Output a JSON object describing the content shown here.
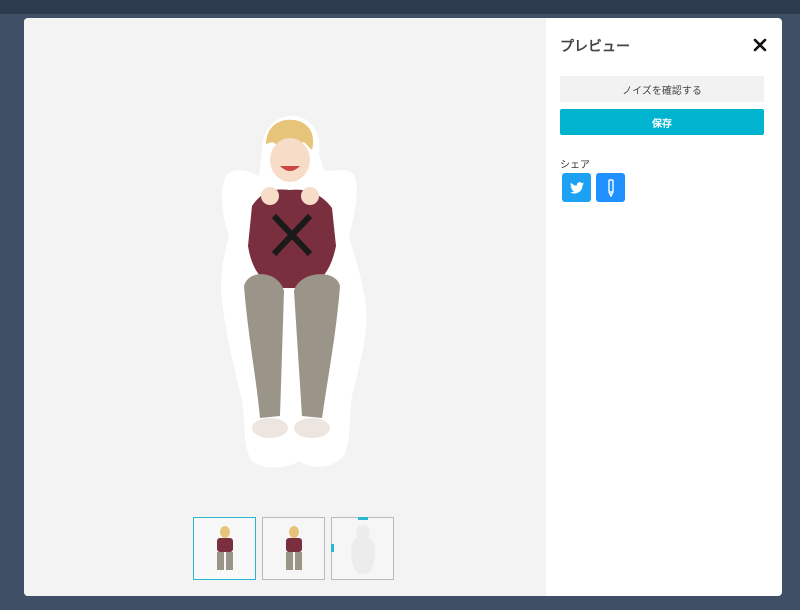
{
  "modal": {
    "title": "プレビュー",
    "close_icon": "close-icon"
  },
  "actions": {
    "noise_label": "ノイズを確認する",
    "save_label": "保存"
  },
  "share": {
    "label": "シェア",
    "buttons": [
      {
        "icon": "twitter-icon",
        "color": "#1da1f2"
      },
      {
        "icon": "pencil-icon",
        "color": "#1e90ff"
      }
    ]
  },
  "thumbnails": [
    {
      "name": "sticker-with-outline",
      "selected": true
    },
    {
      "name": "sticker-standard",
      "selected": false
    },
    {
      "name": "sticker-cut-line",
      "selected": false
    }
  ],
  "colors": {
    "accent": "#00b4cf",
    "overlay": "#3f5066"
  }
}
